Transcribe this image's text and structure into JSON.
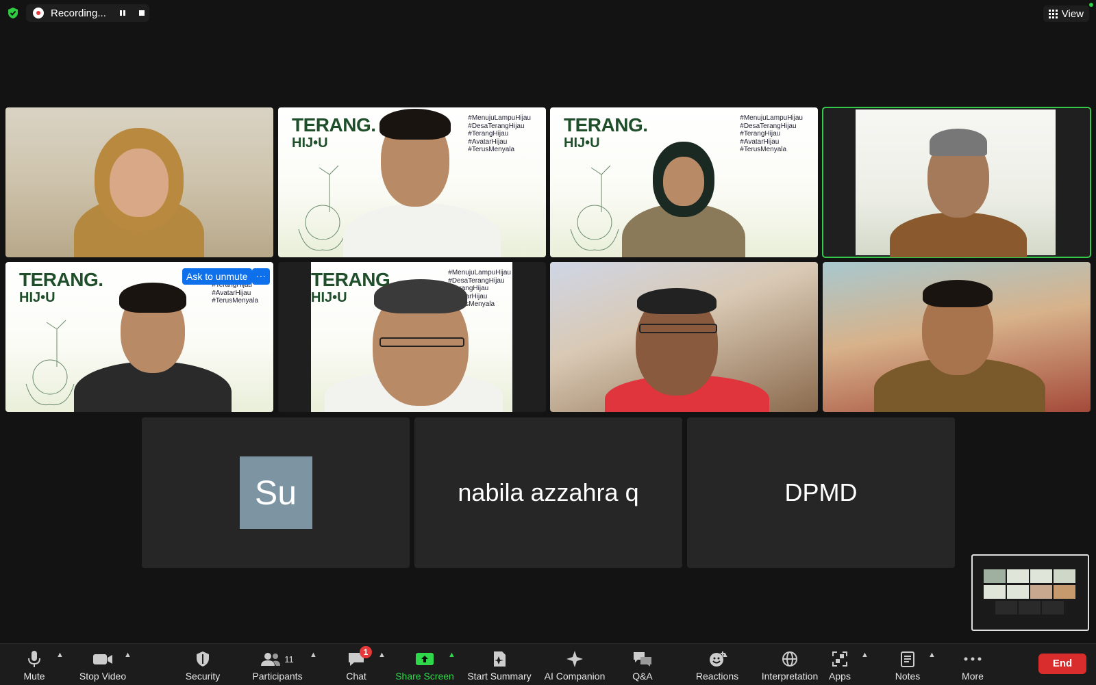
{
  "recording": {
    "label": "Recording..."
  },
  "view": {
    "label": "View"
  },
  "branding": {
    "logo_line1": "TERANG.",
    "logo_line2": "HIJ•U",
    "hashtags": [
      "#MenujuLampuHijau",
      "#DesaTerangHijau",
      "#TerangHijau",
      "#AvatarHijau",
      "#TerusMenyala"
    ]
  },
  "tiles": {
    "ask_to_unmute": "Ask to unmute",
    "more": "···",
    "avatar_initials": "Su",
    "name_tile_2": "nabila azzahra q",
    "name_tile_3": "DPMD"
  },
  "toolbar": {
    "mute": "Mute",
    "stop_video": "Stop Video",
    "security": "Security",
    "participants": "Participants",
    "participants_count": "11",
    "chat": "Chat",
    "chat_badge": "1",
    "share_screen": "Share Screen",
    "start_summary": "Start Summary",
    "ai_companion": "AI Companion",
    "qa": "Q&A",
    "reactions": "Reactions",
    "interpretation": "Interpretation",
    "apps": "Apps",
    "notes": "Notes",
    "more": "More",
    "end": "End"
  },
  "colors": {
    "accent": "#0e71eb",
    "active_speaker": "#34c94a",
    "end": "#d92c2c",
    "share": "#2fd84b"
  }
}
